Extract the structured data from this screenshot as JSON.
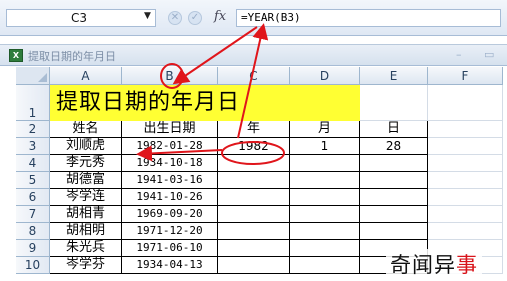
{
  "formula_bar": {
    "name_box": "C3",
    "formula": "=YEAR(B3)",
    "fx_label": "fx"
  },
  "workbook": {
    "title": "提取日期的年月日",
    "icon": "excel-workbook-icon",
    "min_glyph": "–",
    "max_glyph": "▭"
  },
  "sheet": {
    "columns": [
      "A",
      "B",
      "C",
      "D",
      "E",
      "F"
    ],
    "rows": [
      "1",
      "2",
      "3",
      "4",
      "5",
      "6",
      "7",
      "8",
      "9",
      "10"
    ],
    "title": "提取日期的年月日",
    "title_color": "#ffff33",
    "headers": [
      "姓名",
      "出生日期",
      "年",
      "月",
      "日"
    ],
    "data": [
      [
        "刘顺虎",
        "1982-01-28",
        "1982",
        "1",
        "28"
      ],
      [
        "李元秀",
        "1934-10-18",
        "",
        "",
        ""
      ],
      [
        "胡德富",
        "1941-03-16",
        "",
        "",
        ""
      ],
      [
        "岑学连",
        "1941-10-26",
        "",
        "",
        ""
      ],
      [
        "胡相青",
        "1969-09-20",
        "",
        "",
        ""
      ],
      [
        "胡相明",
        "1971-12-20",
        "",
        "",
        ""
      ],
      [
        "朱光兵",
        "1971-06-10",
        "",
        "",
        ""
      ],
      [
        "岑学芬",
        "1934-04-13",
        "",
        "",
        ""
      ]
    ]
  },
  "annotation_color": "#e0151b",
  "watermark": {
    "black": "奇闻异",
    "red": "事"
  }
}
